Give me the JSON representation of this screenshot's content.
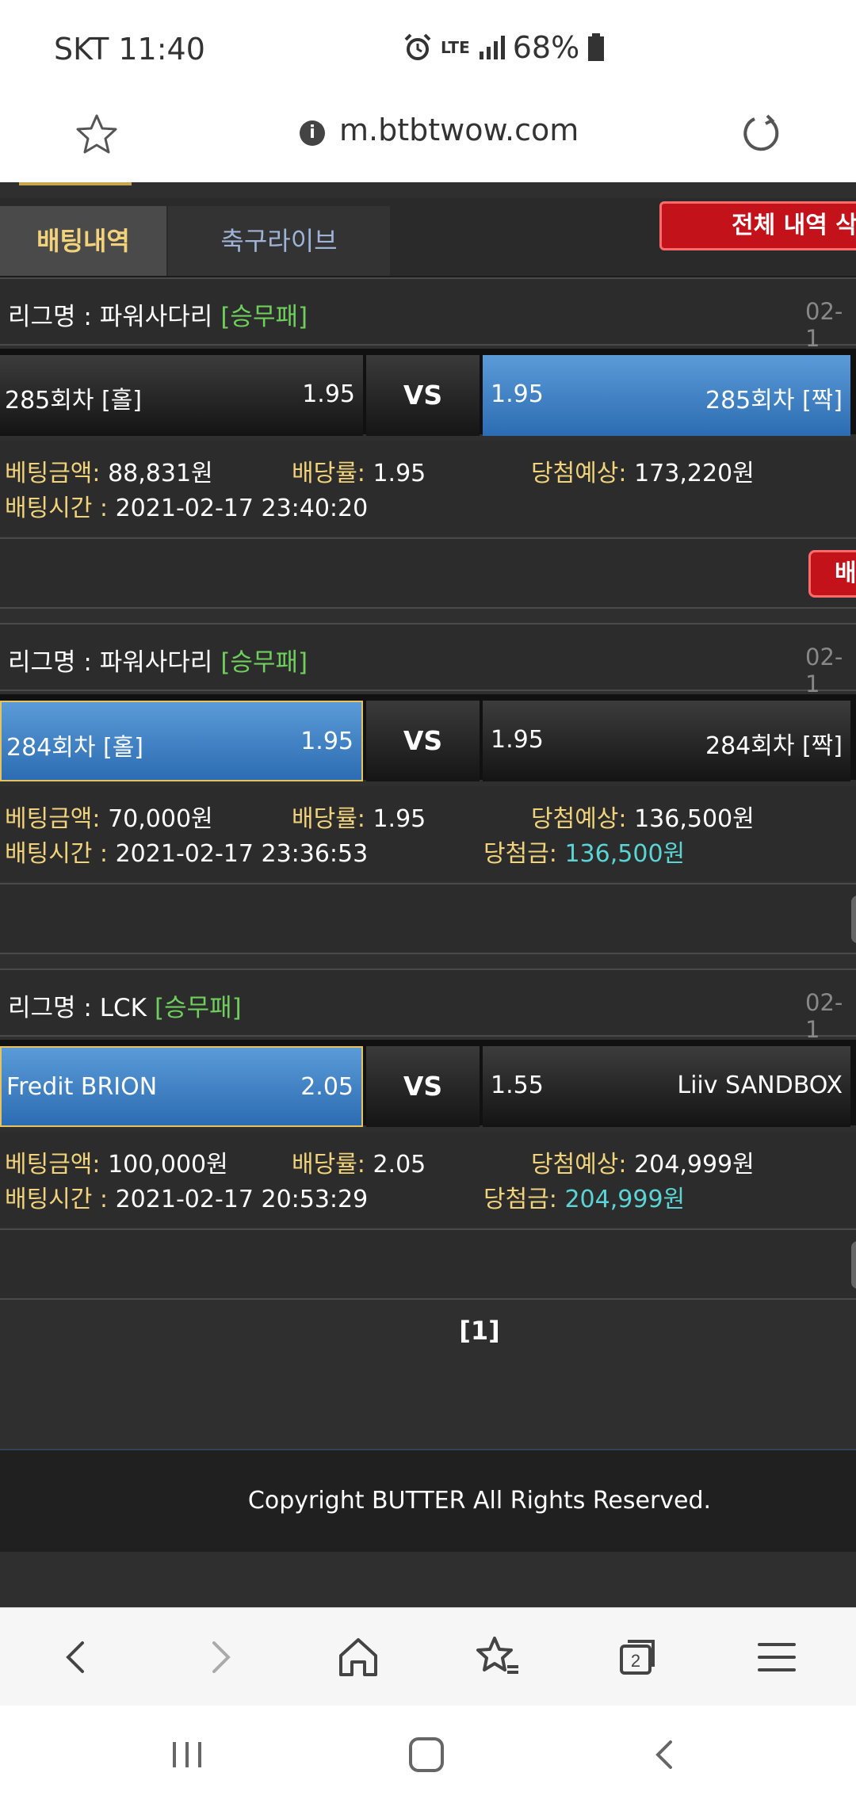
{
  "status": {
    "carrier_time": "SKT 11:40",
    "network": "LTE",
    "battery": "68%"
  },
  "browser": {
    "url": "m.btbtwow.com"
  },
  "tabs": {
    "active": "배팅내역",
    "inactive": "축구라이브",
    "delete_all": "전체 내역 삭"
  },
  "bets": [
    {
      "league_prefix": "리그명 : ",
      "league": "파워사다리",
      "tag": "[승무패]",
      "date": "02-1",
      "home_team": "285회차 [홀]",
      "home_odds": "1.95",
      "vs": "VS",
      "away_odds": "1.95",
      "away_team": "285회차 [짝]",
      "selected": "away",
      "amount_label": "베팅금액:",
      "amount": "88,831원",
      "rate_label": "배당률:",
      "rate": "1.95",
      "expect_label": "당첨예상:",
      "expect": "173,220원",
      "time_label": "배팅시간 :",
      "time": "2021-02-17 23:40:20",
      "win_label": "",
      "win": "",
      "action_label": "배"
    },
    {
      "league_prefix": "리그명 : ",
      "league": "파워사다리",
      "tag": "[승무패]",
      "date": "02-1",
      "home_team": "284회차 [홀]",
      "home_odds": "1.95",
      "vs": "VS",
      "away_odds": "1.95",
      "away_team": "284회차 [짝]",
      "selected": "home",
      "amount_label": "베팅금액:",
      "amount": "70,000원",
      "rate_label": "배당률:",
      "rate": "1.95",
      "expect_label": "당첨예상:",
      "expect": "136,500원",
      "time_label": "배팅시간 :",
      "time": "2021-02-17 23:36:53",
      "win_label": "당첨금:",
      "win": "136,500원",
      "action_label": ""
    },
    {
      "league_prefix": "리그명 : ",
      "league": "LCK",
      "tag": "[승무패]",
      "date": "02-1",
      "home_team": "Fredit BRION",
      "home_odds": "2.05",
      "vs": "VS",
      "away_odds": "1.55",
      "away_team": "Liiv SANDBOX",
      "selected": "home",
      "amount_label": "베팅금액:",
      "amount": "100,000원",
      "rate_label": "배당률:",
      "rate": "2.05",
      "expect_label": "당첨예상:",
      "expect": "204,999원",
      "time_label": "배팅시간 :",
      "time": "2021-02-17 20:53:29",
      "win_label": "당첨금:",
      "win": "204,999원",
      "action_label": ""
    }
  ],
  "pager": {
    "current": "[1]"
  },
  "footer": {
    "copyright": "Copyright BUTTER All Rights Reserved."
  },
  "colors": {
    "accent_red": "#c4121b",
    "selected_blue": "#3a7cc4",
    "win_cyan": "#5ad4d4",
    "label_gold": "#f0d37a",
    "tag_green": "#6fcf5d"
  },
  "icons": {
    "bottombar": [
      "back-arrow-icon",
      "forward-arrow-icon",
      "home-icon",
      "bookmarks-icon",
      "tabs-icon",
      "menu-icon"
    ],
    "sysnav": [
      "recents-icon",
      "home-button-icon",
      "back-icon"
    ],
    "tabs_count": "2"
  }
}
